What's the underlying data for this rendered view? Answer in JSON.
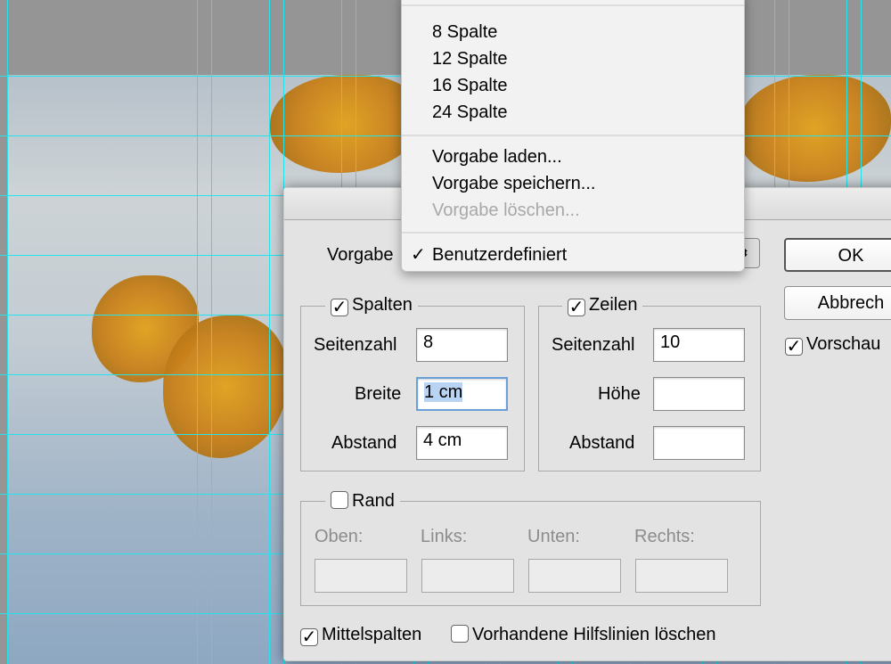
{
  "menu": {
    "items": [
      {
        "label": "8 Spalte",
        "enabled": true
      },
      {
        "label": "12 Spalte",
        "enabled": true
      },
      {
        "label": "16 Spalte",
        "enabled": true
      },
      {
        "label": "24 Spalte",
        "enabled": true
      },
      {
        "label": "Vorgabe laden...",
        "enabled": true
      },
      {
        "label": "Vorgabe speichern...",
        "enabled": true
      },
      {
        "label": "Vorgabe löschen...",
        "enabled": false
      },
      {
        "label": "Benutzerdefiniert",
        "enabled": true,
        "checked": true
      }
    ],
    "check_glyph": "✓"
  },
  "dialog": {
    "preset_label": "Vorgabe",
    "ok": "OK",
    "cancel": "Abbrech",
    "preview": "Vorschau",
    "preview_checked": true,
    "columns": {
      "title": "Spalten",
      "checked": true,
      "count_label": "Seitenzahl",
      "count": "8",
      "width_label": "Breite",
      "width": "1 cm",
      "gutter_label": "Abstand",
      "gutter": "4 cm"
    },
    "rows": {
      "title": "Zeilen",
      "checked": true,
      "count_label": "Seitenzahl",
      "count": "10",
      "height_label": "Höhe",
      "height": "",
      "gutter_label": "Abstand",
      "gutter": ""
    },
    "margin": {
      "title": "Rand",
      "checked": false,
      "top_label": "Oben:",
      "left_label": "Links:",
      "bottom_label": "Unten:",
      "right_label": "Rechts:"
    },
    "center_columns": "Mittelspalten",
    "center_columns_checked": true,
    "clear_guides": "Vorhandene Hilfslinien löschen",
    "clear_guides_checked": false
  },
  "colors": {
    "guide": "#22e4ec",
    "selection": "#b8d4f2"
  }
}
